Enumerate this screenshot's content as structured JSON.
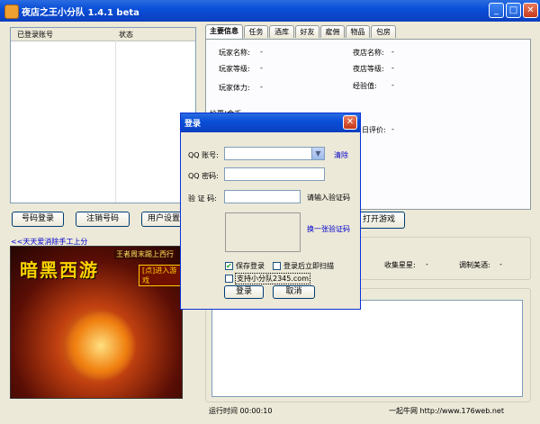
{
  "window": {
    "title": "夜店之王小分队 1.4.1 beta",
    "min": "_",
    "max": "□",
    "close": "✕"
  },
  "accounts": {
    "col_account": "已登录账号",
    "col_status": "状态"
  },
  "buttons": {
    "login": "号码登录",
    "logout": "注销号码",
    "user_settings": "用户设置",
    "open_game": "打开游戏"
  },
  "tabs": [
    "主要信息",
    "任务",
    "酒库",
    "好友",
    "雇佣",
    "物品",
    "包房"
  ],
  "info": {
    "player_name_label": "玩家名称:",
    "player_name_value": "-",
    "player_level_label": "玩家等级:",
    "player_level_value": "-",
    "player_stamina_label": "玩家体力:",
    "player_stamina_value": "-",
    "club_name_label": "夜店名称:",
    "club_name_value": "-",
    "club_level_label": "夜店等级:",
    "club_level_value": "-",
    "exp_label": "经验值:",
    "exp_value": "-",
    "gold_label": "检票(金币:",
    "gold_value": "-",
    "rating_label": "日评价:",
    "rating_value": "-"
  },
  "stats": {
    "stars_label": "收集星星:",
    "stars_value": "-",
    "drinks_label": "调制美酒:",
    "drinks_value": "-"
  },
  "ad": {
    "link": "<<天天爱消除手工上分",
    "title": "暗黑西游",
    "tag": "王者周末踢上西行",
    "enter": "[点]进入游戏"
  },
  "status": {
    "runtime": "运行时间 00:00:10",
    "site": "一起牛网 http://www.176web.net"
  },
  "dialog": {
    "title": "登录",
    "qq_label": "QQ 账号:",
    "qq_value": "",
    "clear": "清除",
    "pwd_label": "QQ 密码:",
    "pwd_value": "",
    "captcha_label": "验 证 码:",
    "captcha_value": "",
    "captcha_hint": "请输入验证码",
    "captcha_refresh": "换一张验证码",
    "save_login": "保存登录",
    "save_login_checked": true,
    "scan_after": "登录后立即扫描",
    "scan_after_checked": false,
    "support": "支持小分队2345.com",
    "support_checked": false,
    "ok": "登录",
    "cancel": "取消"
  }
}
